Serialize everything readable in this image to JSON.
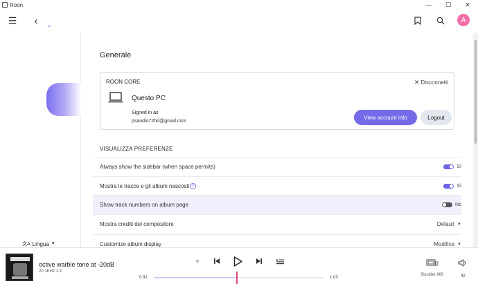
{
  "window": {
    "title": "Roon"
  },
  "toolbar": {
    "avatar_letter": "A"
  },
  "sidebar": {
    "language_label": "Lingua"
  },
  "main": {
    "section_title": "Generale",
    "core": {
      "label": "ROON CORE",
      "disconnect": "Disconnetti",
      "pc_name": "Questo PC",
      "signed_in": "Signed in as",
      "email": "psaudio72hd@gmail.com",
      "view_account": "View account info",
      "logout": "Logout"
    },
    "prefs_title": "VISUALIZZA PREFERENZE",
    "prefs": [
      {
        "label": "Always show the sidebar (when space permits)",
        "control": "toggle",
        "state": "on",
        "value": "Sì"
      },
      {
        "label": "Mostra le tracce e gli album nascosti",
        "control": "toggle",
        "state": "on",
        "value": "Sì",
        "help": true
      },
      {
        "label": "Show track numbers on album page",
        "control": "toggle",
        "state": "off",
        "value": "No",
        "highlighted": true
      },
      {
        "label": "Mostra crediti del compositore",
        "control": "dropdown",
        "value": "Default"
      },
      {
        "label": "Customize album display",
        "control": "dropdown",
        "value": "Modifica"
      }
    ]
  },
  "player": {
    "track_title": "octive warble tone at -20dB",
    "track_meta": "20 1KHz 1.3",
    "elapsed": "0:31",
    "duration": "1:03",
    "progress": 0.49,
    "zone": "Boulder 866",
    "volume": "42"
  },
  "colors": {
    "accent": "#756ae8",
    "avatar": "#f06fa8",
    "playhead": "#e2457a"
  }
}
